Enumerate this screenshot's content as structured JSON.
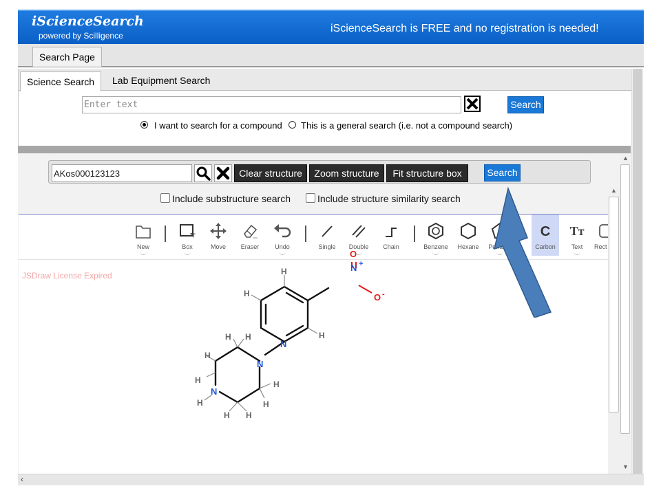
{
  "header": {
    "logo_title": "iScienceSearch",
    "logo_subtitle": "powered by Scilligence",
    "notice": "iScienceSearch is FREE and no registration is needed!"
  },
  "main_tabs": [
    {
      "label": "Search Page"
    }
  ],
  "sub_tabs": [
    {
      "label": "Science Search"
    },
    {
      "label": "Lab Equipment Search"
    }
  ],
  "text_search": {
    "placeholder": "Enter text",
    "value": "",
    "search_label": "Search",
    "radio_compound": "I want to search for a compound",
    "radio_general": "This is a general search (i.e. not a compound search)",
    "selected": "compound"
  },
  "structure_search": {
    "input_value": "AKos000123123",
    "clear_label": "Clear structure",
    "zoom_label": "Zoom structure",
    "fit_label": "Fit structure box",
    "search_label": "Search",
    "substructure_label": "Include substructure search",
    "similarity_label": "Include structure similarity search"
  },
  "jsdraw": {
    "license_notice": "JSDraw License Expired",
    "tools": [
      {
        "label": "New",
        "icon": "new-icon"
      },
      {
        "label": "Box",
        "icon": "box-select-icon"
      },
      {
        "label": "Move",
        "icon": "move-icon"
      },
      {
        "label": "Eraser",
        "icon": "eraser-icon"
      },
      {
        "label": "Undo",
        "icon": "undo-icon"
      },
      {
        "label": "Single",
        "icon": "single-bond-icon"
      },
      {
        "label": "Double",
        "icon": "double-bond-icon"
      },
      {
        "label": "Chain",
        "icon": "chain-icon"
      },
      {
        "label": "Benzene",
        "icon": "benzene-icon"
      },
      {
        "label": "Hexane",
        "icon": "hexane-icon"
      },
      {
        "label": "Pentane",
        "icon": "pentane-icon"
      },
      {
        "label": "Carbon",
        "icon": "carbon-icon"
      },
      {
        "label": "Text",
        "icon": "text-icon"
      },
      {
        "label": "Rect",
        "icon": "rect-icon"
      }
    ]
  },
  "molecule_atoms": {
    "N": "N",
    "O": "O",
    "H": "H",
    "plus": "+",
    "minus": "-"
  },
  "colors": {
    "header_blue": "#0a5fc5",
    "button_blue": "#1a78d6",
    "nitrogen_blue": "#2055d6",
    "oxygen_red": "#e01b1b",
    "annotation_arrow": "#4a7ebb"
  }
}
